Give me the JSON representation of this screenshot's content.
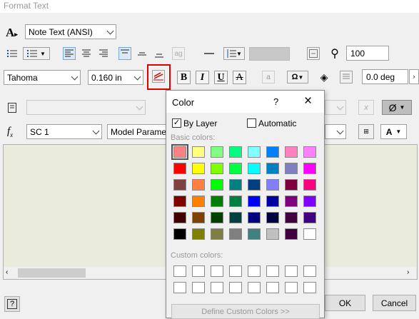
{
  "window": {
    "title": "Format Text"
  },
  "toolbar1": {
    "style_value": "Note Text (ANSI)"
  },
  "toolbar2": {
    "width_value": "100"
  },
  "toolbar3": {
    "font_value": "Tahoma",
    "size_value": "0.160 in",
    "bold": "B",
    "italic": "I",
    "underline": "U",
    "strike": "A",
    "rotation_value": "0.0 deg"
  },
  "toolbar4": {
    "empty_symbol": "Ø"
  },
  "toolbar5": {
    "fx": "f",
    "component_value": "SC 1",
    "source_value": "Model Parameters",
    "case_label": "A"
  },
  "dialog": {
    "title": "Color",
    "help": "?",
    "close": "×",
    "by_layer_label": "By Layer",
    "automatic_label": "Automatic",
    "basic_label": "Basic colors:",
    "custom_label": "Custom colors:",
    "define_label": "Define Custom Colors >>",
    "basic_colors": [
      [
        "#ff8080",
        "#ffff80",
        "#80ff80",
        "#00ff80",
        "#80ffff",
        "#0080ff",
        "#ff80c0",
        "#ff80ff"
      ],
      [
        "#ff0000",
        "#ffff00",
        "#80ff00",
        "#00ff40",
        "#00ffff",
        "#0080c0",
        "#8080c0",
        "#ff00ff"
      ],
      [
        "#804040",
        "#ff8040",
        "#00ff00",
        "#008080",
        "#004080",
        "#8080ff",
        "#800040",
        "#ff0080"
      ],
      [
        "#800000",
        "#ff8000",
        "#008000",
        "#008040",
        "#0000ff",
        "#0000a0",
        "#800080",
        "#8000ff"
      ],
      [
        "#400000",
        "#804000",
        "#004000",
        "#004040",
        "#000080",
        "#000040",
        "#400040",
        "#400080"
      ],
      [
        "#000000",
        "#808000",
        "#808040",
        "#808080",
        "#408080",
        "#c0c0c0",
        "#400040",
        "#ffffff"
      ]
    ]
  },
  "buttons": {
    "help": "?",
    "ok": "OK",
    "cancel": "Cancel"
  }
}
